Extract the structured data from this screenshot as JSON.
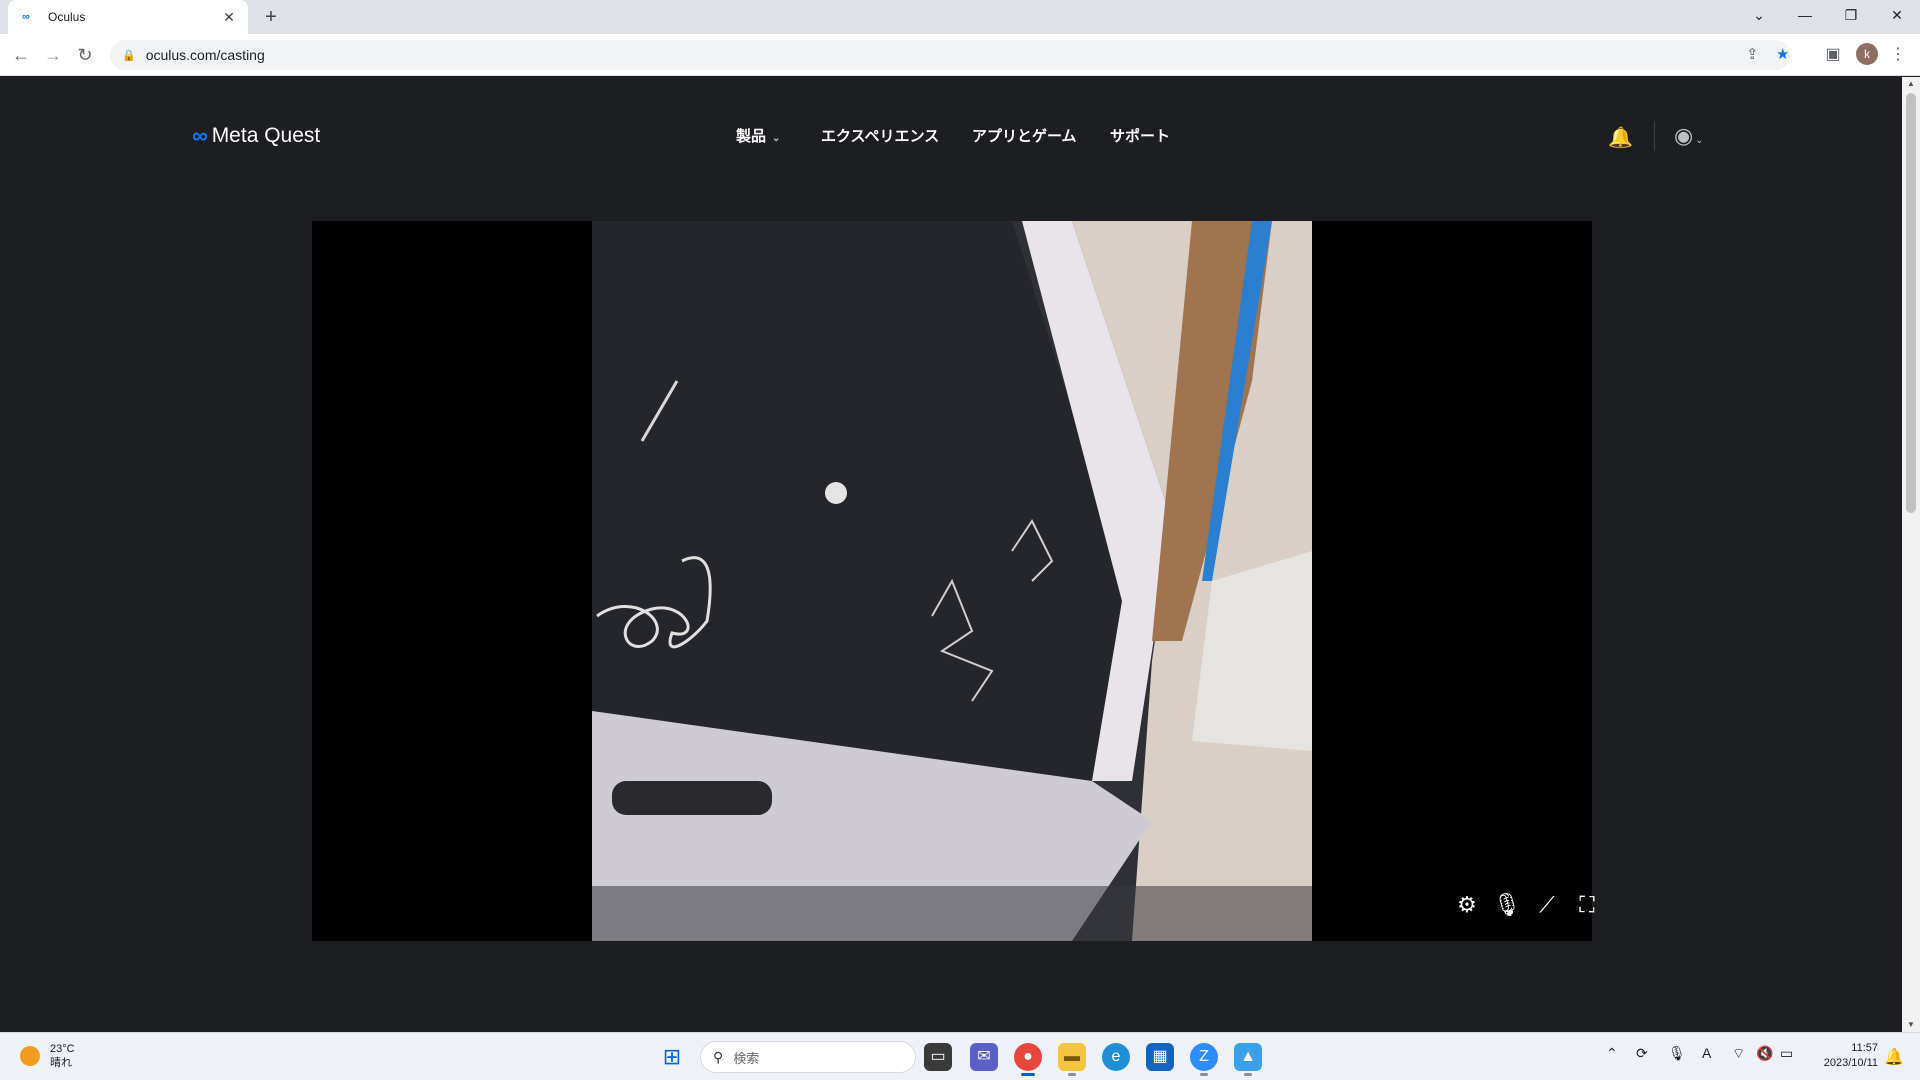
{
  "browser": {
    "tab_title": "Oculus",
    "tab_favicon": "∞",
    "new_tab": "+",
    "url": "oculus.com/casting",
    "profile_initial": "k"
  },
  "site": {
    "brand": "Meta Quest",
    "nav": [
      "製品",
      "エクスペリエンス",
      "アプリとゲーム",
      "サポート"
    ],
    "accent": "#0a7cff"
  },
  "player": {
    "controls": [
      "settings-icon",
      "mic-off-icon",
      "cast-off-icon",
      "fullscreen-icon"
    ]
  },
  "taskbar": {
    "temperature": "23°C",
    "weather": "晴れ",
    "search_placeholder": "検索",
    "time": "11:57",
    "date": "2023/10/11",
    "ime": "A"
  }
}
